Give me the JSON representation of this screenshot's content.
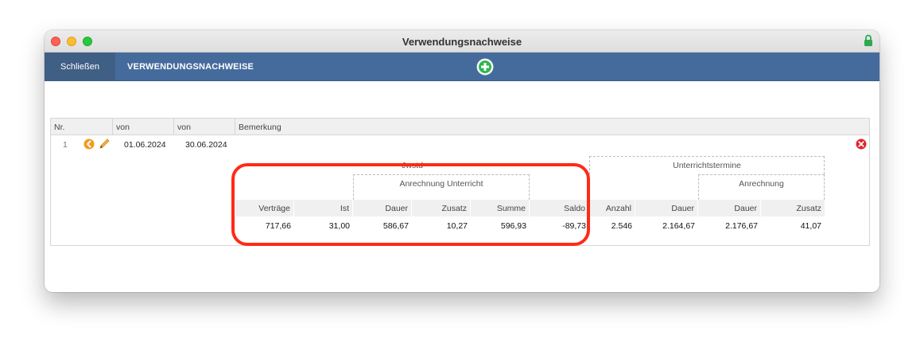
{
  "window": {
    "title": "Verwendungsnachweise"
  },
  "toolbar": {
    "close_label": "Schließen",
    "section_label": "VERWENDUNGSNACHWEISE"
  },
  "table": {
    "headers": [
      "Nr.",
      "von",
      "von",
      "Bemerkung"
    ],
    "row": {
      "nr": "1",
      "from": "01.06.2024",
      "to": "30.06.2024",
      "remark": ""
    }
  },
  "summary": {
    "group_jwstd": "Jwstd",
    "group_unterricht": "Unterrichtstermine",
    "sub_anrechnung_unterricht": "Anrechnung Unterricht",
    "sub_anrechnung": "Anrechnung",
    "columns": [
      "Verträge",
      "Ist",
      "Dauer",
      "Zusatz",
      "Summe",
      "Saldo",
      "Anzahl",
      "Dauer",
      "Dauer",
      "Zusatz"
    ],
    "values": [
      "717,66",
      "31,00",
      "586,67",
      "10,27",
      "596,93",
      "-89,73",
      "2.546",
      "2.164,67",
      "2.176,67",
      "41,07"
    ]
  },
  "colors": {
    "toolbar": "#456b9c",
    "highlight": "#ff2a16",
    "accent_orange": "#f39a1e"
  }
}
